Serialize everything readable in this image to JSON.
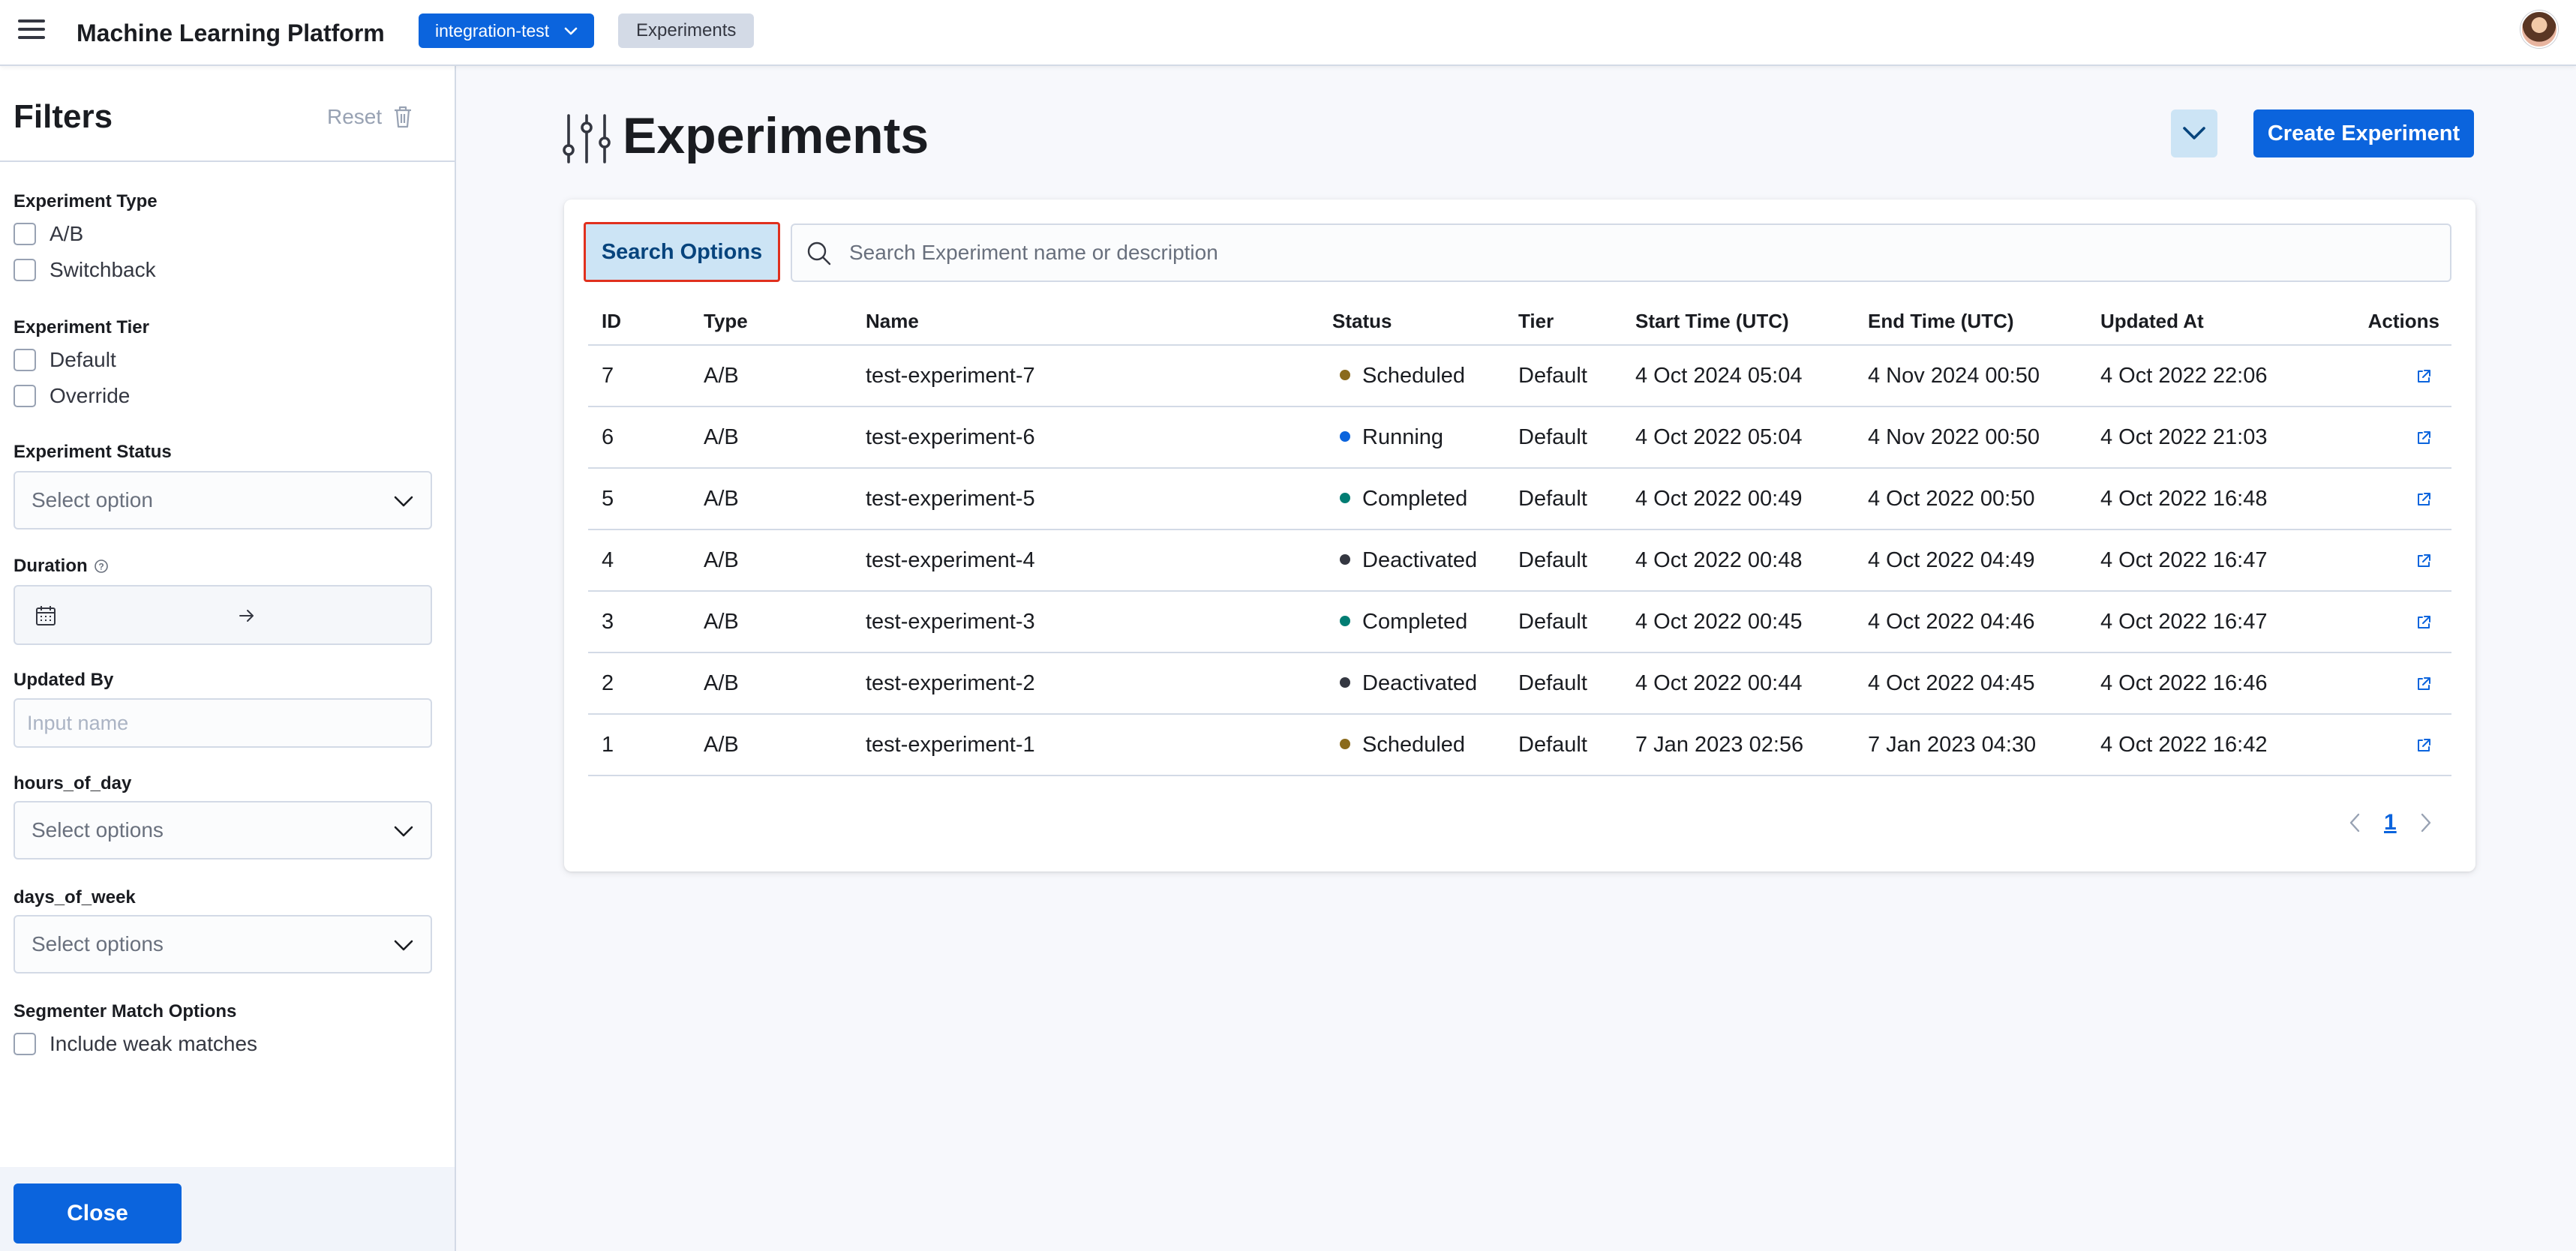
{
  "header": {
    "app_title": "Machine Learning Platform",
    "environment": "integration-test",
    "breadcrumb": "Experiments"
  },
  "sidebar": {
    "title": "Filters",
    "reset_label": "Reset",
    "experiment_type": {
      "label": "Experiment Type",
      "options": [
        "A/B",
        "Switchback"
      ]
    },
    "experiment_tier": {
      "label": "Experiment Tier",
      "options": [
        "Default",
        "Override"
      ]
    },
    "experiment_status": {
      "label": "Experiment Status",
      "placeholder": "Select option"
    },
    "duration": {
      "label": "Duration"
    },
    "updated_by": {
      "label": "Updated By",
      "placeholder": "Input name"
    },
    "hours_of_day": {
      "label": "hours_of_day",
      "placeholder": "Select options"
    },
    "days_of_week": {
      "label": "days_of_week",
      "placeholder": "Select options"
    },
    "segmenter": {
      "label": "Segmenter Match Options",
      "option": "Include weak matches"
    },
    "close_label": "Close"
  },
  "main": {
    "title": "Experiments",
    "create_label": "Create Experiment",
    "search_options_label": "Search Options",
    "search_placeholder": "Search Experiment name or description",
    "columns": [
      "ID",
      "Type",
      "Name",
      "Status",
      "Tier",
      "Start Time (UTC)",
      "End Time (UTC)",
      "Updated At",
      "Actions"
    ],
    "rows": [
      {
        "id": "7",
        "type": "A/B",
        "name": "test-experiment-7",
        "status": "Scheduled",
        "status_color": "#8a6a1c",
        "tier": "Default",
        "start": "4 Oct 2024 05:04",
        "end": "4 Nov 2024 00:50",
        "updated": "4 Oct 2022 22:06"
      },
      {
        "id": "6",
        "type": "A/B",
        "name": "test-experiment-6",
        "status": "Running",
        "status_color": "#0b64dd",
        "tier": "Default",
        "start": "4 Oct 2022 05:04",
        "end": "4 Nov 2022 00:50",
        "updated": "4 Oct 2022 21:03"
      },
      {
        "id": "5",
        "type": "A/B",
        "name": "test-experiment-5",
        "status": "Completed",
        "status_color": "#017d73",
        "tier": "Default",
        "start": "4 Oct 2022 00:49",
        "end": "4 Oct 2022 00:50",
        "updated": "4 Oct 2022 16:48"
      },
      {
        "id": "4",
        "type": "A/B",
        "name": "test-experiment-4",
        "status": "Deactivated",
        "status_color": "#343741",
        "tier": "Default",
        "start": "4 Oct 2022 00:48",
        "end": "4 Oct 2022 04:49",
        "updated": "4 Oct 2022 16:47"
      },
      {
        "id": "3",
        "type": "A/B",
        "name": "test-experiment-3",
        "status": "Completed",
        "status_color": "#017d73",
        "tier": "Default",
        "start": "4 Oct 2022 00:45",
        "end": "4 Oct 2022 04:46",
        "updated": "4 Oct 2022 16:47"
      },
      {
        "id": "2",
        "type": "A/B",
        "name": "test-experiment-2",
        "status": "Deactivated",
        "status_color": "#343741",
        "tier": "Default",
        "start": "4 Oct 2022 00:44",
        "end": "4 Oct 2022 04:45",
        "updated": "4 Oct 2022 16:46"
      },
      {
        "id": "1",
        "type": "A/B",
        "name": "test-experiment-1",
        "status": "Scheduled",
        "status_color": "#8a6a1c",
        "tier": "Default",
        "start": "7 Jan 2023 02:56",
        "end": "7 Jan 2023 04:30",
        "updated": "4 Oct 2022 16:42"
      }
    ],
    "pagination": {
      "current_page": "1"
    }
  }
}
